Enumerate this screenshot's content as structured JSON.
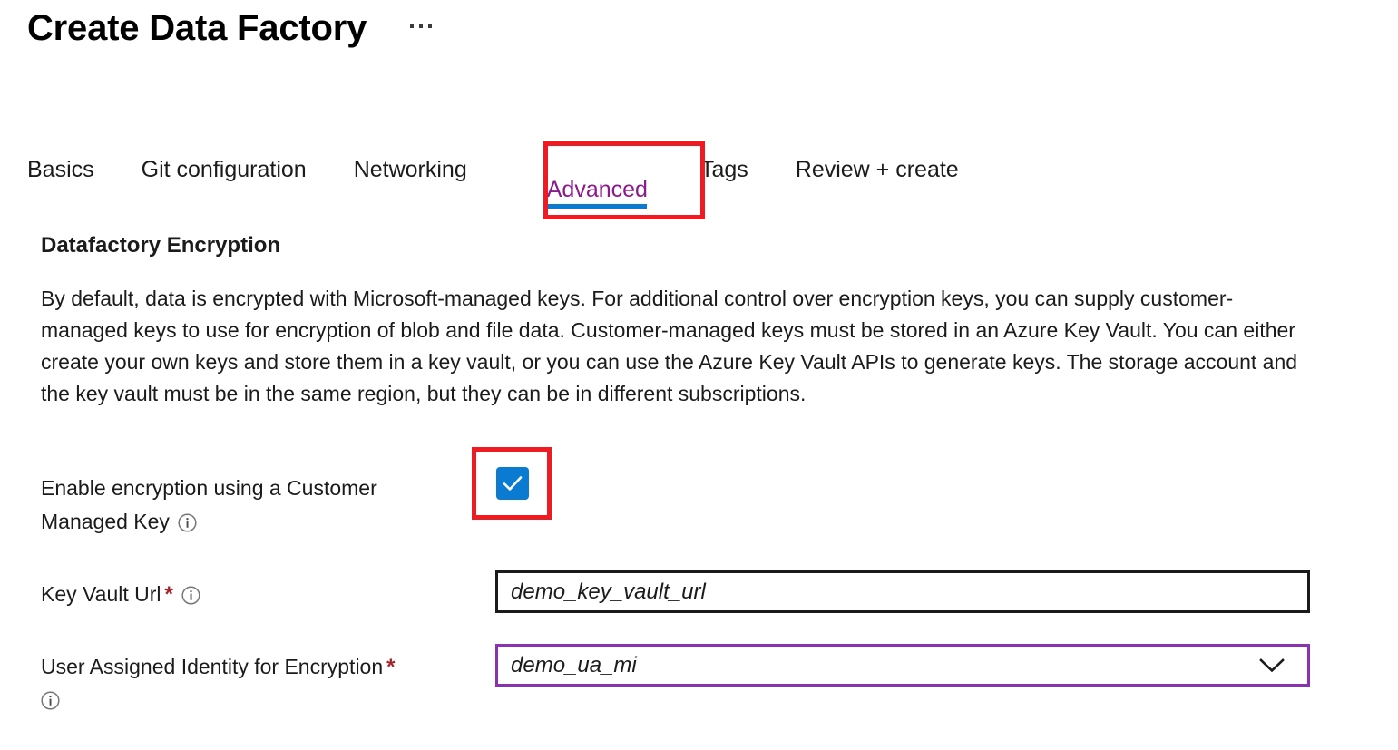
{
  "header": {
    "title": "Create Data Factory",
    "more_menu": "…"
  },
  "tabs": [
    {
      "label": "Basics",
      "active": false
    },
    {
      "label": "Git configuration",
      "active": false
    },
    {
      "label": "Networking",
      "active": false
    },
    {
      "label": "Advanced",
      "active": true
    },
    {
      "label": "Tags",
      "active": false
    },
    {
      "label": "Review + create",
      "active": false
    }
  ],
  "section": {
    "heading": "Datafactory Encryption",
    "description": "By default, data is encrypted with Microsoft-managed keys. For additional control over encryption keys, you can supply customer-managed keys to use for encryption of blob and file data. Customer-managed keys must be stored in an Azure Key Vault. You can either create your own keys and store them in a key vault, or you can use the Azure Key Vault APIs to generate keys. The storage account and the key vault must be in the same region, but they can be in different subscriptions."
  },
  "form": {
    "enable_encryption": {
      "label": "Enable encryption using a Customer Managed Key",
      "checked": true
    },
    "key_vault_url": {
      "label": "Key Vault Url",
      "required_marker": "*",
      "value": "demo_key_vault_url",
      "placeholder": ""
    },
    "user_assigned_identity": {
      "label": "User Assigned Identity for Encryption",
      "required_marker": "*",
      "value": "demo_ua_mi"
    }
  },
  "colors": {
    "accent_blue": "#0a7bd0",
    "active_tab_purple": "#8b1a8b",
    "annotation_red": "#ef1b23",
    "focus_purple": "#8b32b0",
    "required_red": "#a4262c"
  }
}
